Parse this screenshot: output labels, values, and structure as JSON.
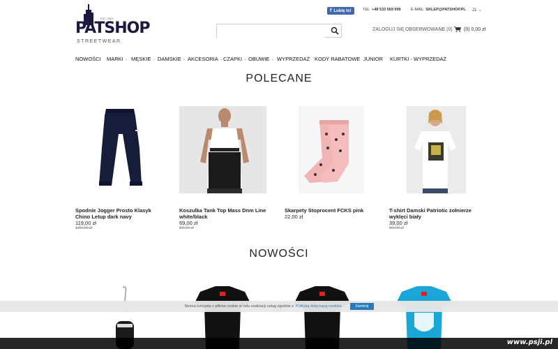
{
  "header": {
    "logo_text": "PATSHOP",
    "logo_sub": "STREETWEAR",
    "logo_est": "EST. 2003",
    "fb_like_label": "Lubię to!",
    "phone_label": "TEL",
    "phone": "+48 533 569 999",
    "email_label": "E-MAIL",
    "email": "SKLEP@PATSHOP.PL",
    "currency": "ZŁ",
    "search_placeholder": "",
    "login_label": "ZALOGUJ SIĘ",
    "wishlist_label": "OBSERWOWANE (0)",
    "cart_label": "(0) 0,00 zł"
  },
  "nav": {
    "items": [
      {
        "label": "NOWOŚCI",
        "dropdown": false
      },
      {
        "label": "MARKI",
        "dropdown": true
      },
      {
        "label": "MĘSKIE",
        "dropdown": true
      },
      {
        "label": "DAMSKIE",
        "dropdown": true
      },
      {
        "label": "AKCESORIA",
        "dropdown": true
      },
      {
        "label": "CZAPKI",
        "dropdown": true
      },
      {
        "label": "OBUWIE",
        "dropdown": true
      },
      {
        "label": "WYPRZEDAŻ",
        "dropdown": false
      },
      {
        "label": "KODY RABATOWE",
        "dropdown": false
      },
      {
        "label": "JUNIOR",
        "dropdown": false
      },
      {
        "label": "KURTKI - WYPRZEDAŻ",
        "dropdown": false
      }
    ]
  },
  "recommended": {
    "title": "POLECANE",
    "products": [
      {
        "name": "Spodnie Jogger Prosto Klasyk Chino Letup dark navy",
        "price": "119,00 zł",
        "old_price": "169,00 zł"
      },
      {
        "name": "Koszulka Tank Top Mass Dnm Line white/black",
        "price": "69,00 zł",
        "old_price": "89,00 zł"
      },
      {
        "name": "Skarpety Stoprocent FCKS pink",
        "price": "22,00 zł",
        "old_price": ""
      },
      {
        "name": "T-shirt Damski Patriotic żołnierze wyklęci biały",
        "price": "39,00 zł",
        "old_price": "69,00 zł"
      }
    ]
  },
  "new_items": {
    "title": "NOWOŚCI"
  },
  "cookie": {
    "text": "Strona korzysta z plików cookie w celu realizacji usług zgodnie z",
    "link": "Polityką dotyczącą cookies.",
    "button": "Zamknij"
  },
  "watermark": "www.psji.pl",
  "colors": {
    "accent": "#2a7ab8",
    "fb": "#4267b2",
    "socks_pink": "#f2b5b5",
    "tee_cyan": "#1aa6d6"
  }
}
